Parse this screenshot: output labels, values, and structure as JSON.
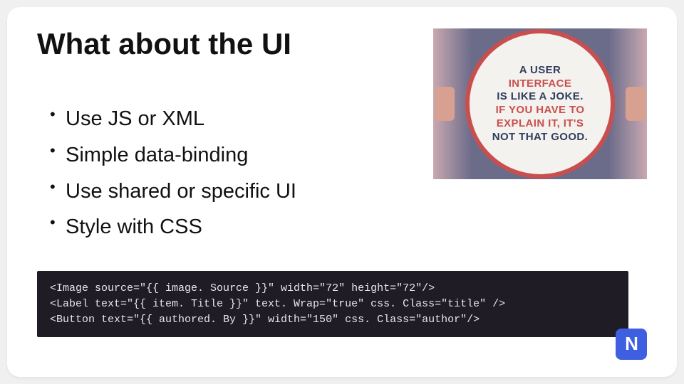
{
  "title": "What about the UI",
  "bullets": [
    "Use JS or XML",
    "Simple data-binding",
    "Use shared or specific UI",
    "Style with CSS"
  ],
  "joke": {
    "l1": "A USER",
    "l2": "INTERFACE",
    "l3": "IS LIKE A JOKE.",
    "l4": "IF YOU HAVE TO EXPLAIN IT, IT'S",
    "l5": "NOT THAT GOOD."
  },
  "code": {
    "line1": "<Image source=\"{{ image. Source }}\" width=\"72\" height=\"72\"/>",
    "line2": "<Label text=\"{{ item. Title }}\" text. Wrap=\"true\" css. Class=\"title\" />",
    "line3": "<Button text=\"{{ authored. By }}\" width=\"150\" css. Class=\"author\"/>"
  },
  "logo": "N"
}
